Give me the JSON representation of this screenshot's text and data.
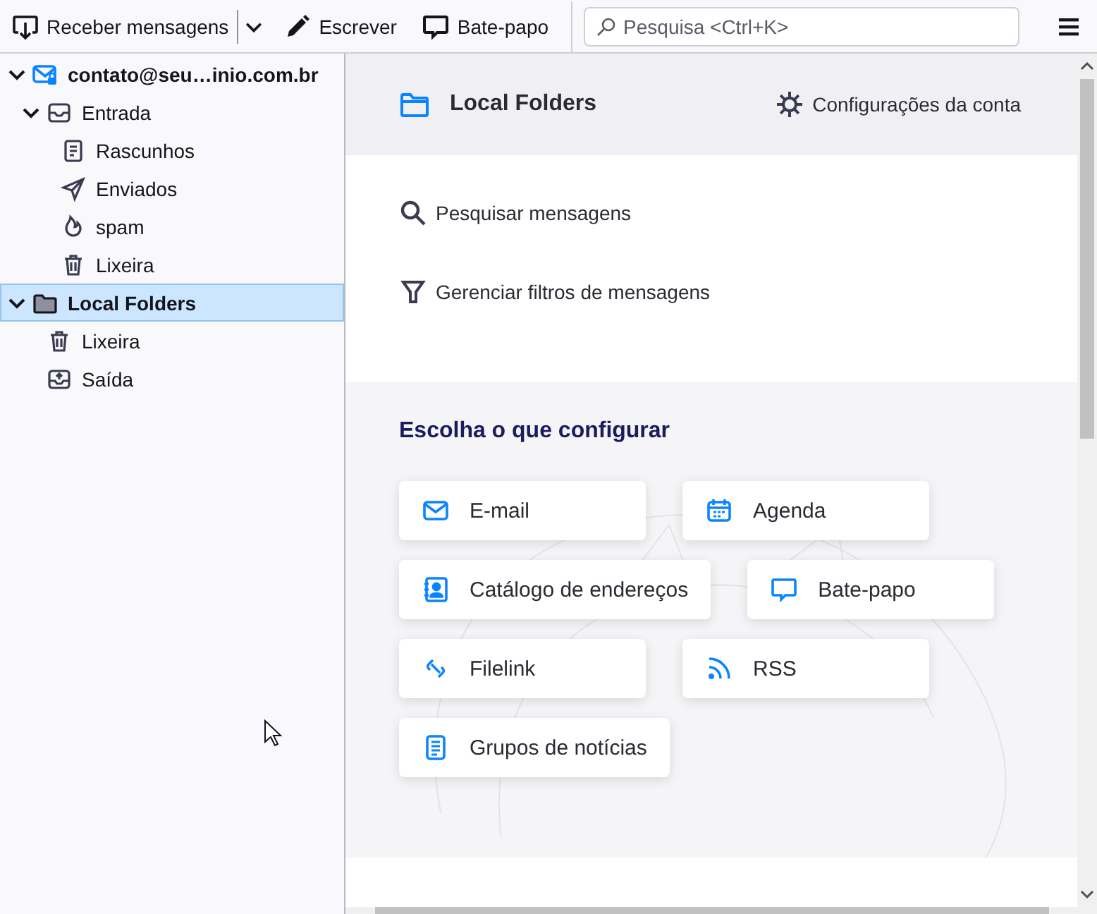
{
  "toolbar": {
    "get_messages": "Receber mensagens",
    "compose": "Escrever",
    "chat": "Bate-papo",
    "search": {
      "placeholder": "Pesquisa <Ctrl+K>"
    }
  },
  "folder_tree": [
    {
      "label": "contato@seu…inio.com.br",
      "kind": "account",
      "expanded": true,
      "selected": false,
      "children": [
        {
          "label": "Entrada",
          "kind": "inbox",
          "expanded": true,
          "selected": false,
          "children": [
            {
              "label": "Rascunhos",
              "kind": "drafts",
              "selected": false
            },
            {
              "label": "Enviados",
              "kind": "sent",
              "selected": false
            },
            {
              "label": "spam",
              "kind": "spam",
              "selected": false
            },
            {
              "label": "Lixeira",
              "kind": "trash",
              "selected": false
            }
          ]
        }
      ]
    },
    {
      "label": "Local Folders",
      "kind": "folder",
      "expanded": true,
      "selected": true,
      "children": [
        {
          "label": "Lixeira",
          "kind": "trash",
          "selected": false
        },
        {
          "label": "Saída",
          "kind": "outbox",
          "selected": false
        }
      ]
    }
  ],
  "account_header": {
    "title": "Local Folders",
    "settings_link": "Configurações da conta"
  },
  "actions": [
    {
      "label": "Pesquisar mensagens",
      "kind": "search"
    },
    {
      "label": "Gerenciar filtros de mensagens",
      "kind": "filter"
    }
  ],
  "setup": {
    "heading": "Escolha o que configurar",
    "cards": [
      {
        "label": "E-mail",
        "kind": "email"
      },
      {
        "label": "Agenda",
        "kind": "calendar"
      },
      {
        "label": "Catálogo de endereços",
        "kind": "addressbook"
      },
      {
        "label": "Bate-papo",
        "kind": "chat"
      },
      {
        "label": "Filelink",
        "kind": "filelink"
      },
      {
        "label": "RSS",
        "kind": "rss"
      },
      {
        "label": "Grupos de notícias",
        "kind": "newsgroups"
      }
    ]
  }
}
